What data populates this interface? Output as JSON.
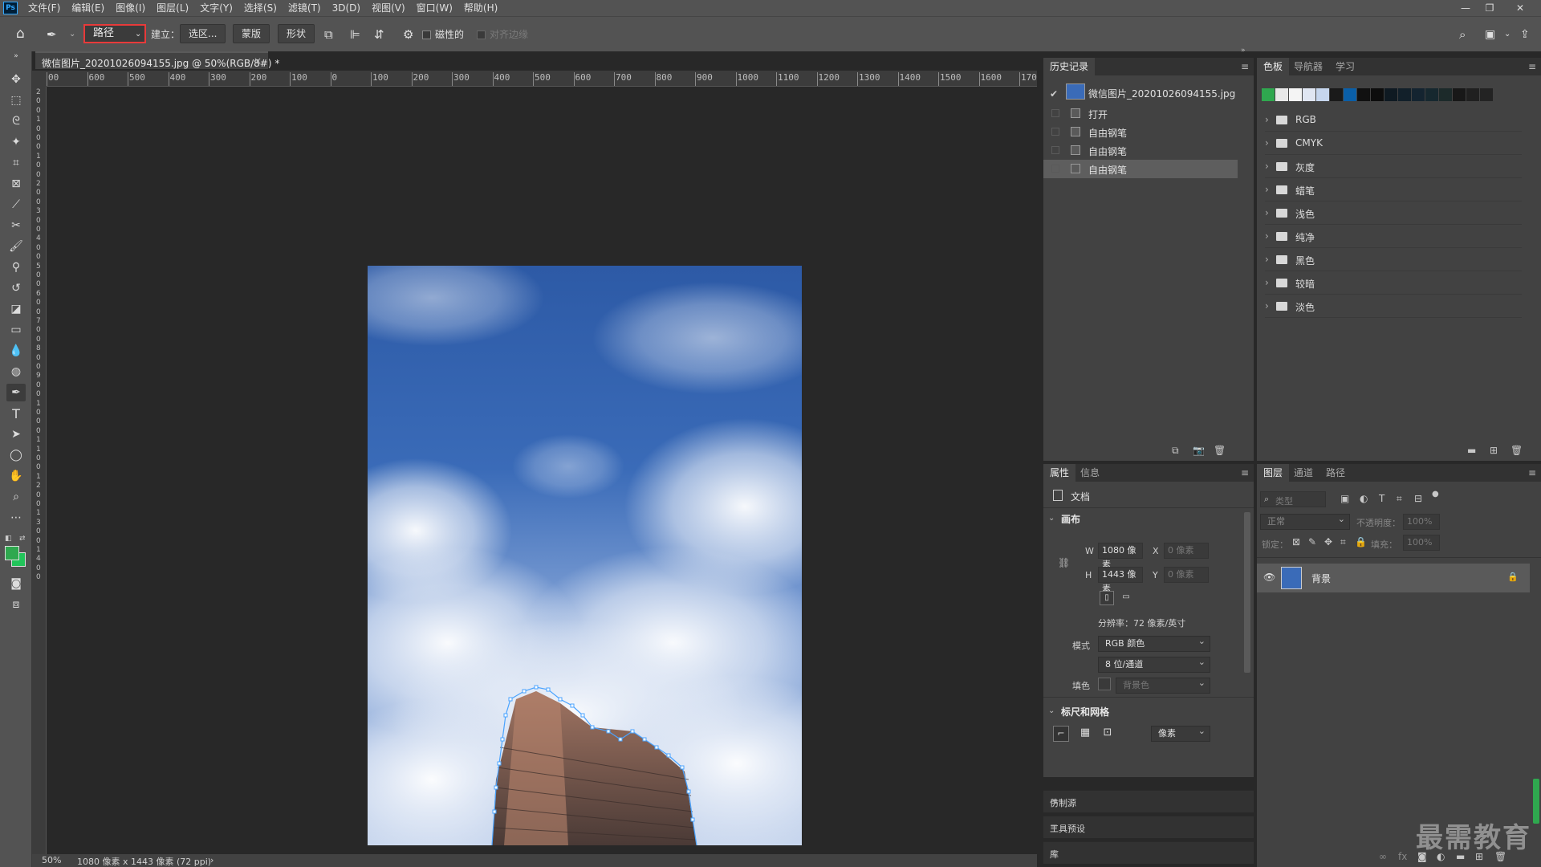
{
  "menu": {
    "logo": "Ps",
    "items": [
      "文件(F)",
      "编辑(E)",
      "图像(I)",
      "图层(L)",
      "文字(Y)",
      "选择(S)",
      "滤镜(T)",
      "3D(D)",
      "视图(V)",
      "窗口(W)",
      "帮助(H)"
    ],
    "window_controls": [
      "—",
      "❐",
      "✕"
    ]
  },
  "options_bar": {
    "mode_select": "路径",
    "build_label": "建立：",
    "selection_button": "选区...",
    "mask_button": "蒙版",
    "shape_button": "形状",
    "magnetic_label": "磁性的",
    "align_edges_label": "对齐边缘"
  },
  "document": {
    "tab_label": "微信图片_20201026094155.jpg @ 50%(RGB/8#) *",
    "close": "×"
  },
  "ruler": {
    "h_ticks": [
      "00",
      "600",
      "500",
      "400",
      "300",
      "200",
      "100",
      "0",
      "100",
      "200",
      "300",
      "400",
      "500",
      "600",
      "700",
      "800",
      "900",
      "1000",
      "1100",
      "1200",
      "1300",
      "1400",
      "1500",
      "1600",
      "1700"
    ],
    "v_ticks": [
      "2",
      "0",
      "0",
      "1",
      "0",
      "0",
      "0",
      "1",
      "0",
      "0",
      "2",
      "0",
      "0",
      "3",
      "0",
      "0",
      "4",
      "0",
      "0",
      "5",
      "0",
      "0",
      "6",
      "0",
      "0",
      "7",
      "0",
      "0",
      "8",
      "0",
      "0",
      "9",
      "0",
      "0",
      "1",
      "0",
      "0",
      "0",
      "1",
      "1",
      "0",
      "0",
      "1",
      "2",
      "0",
      "0",
      "1",
      "3",
      "0",
      "0",
      "1",
      "4",
      "0",
      "0"
    ]
  },
  "status": {
    "zoom": "50%",
    "doc_info": "1080 像素 x 1443 像素 (72 ppi)",
    "arrow": "›"
  },
  "history": {
    "tab": "历史记录",
    "snapshot_name": "微信图片_20201026094155.jpg",
    "rows": [
      "打开",
      "自由钢笔",
      "自由钢笔",
      "自由钢笔"
    ],
    "selected_index": 3
  },
  "swatches": {
    "tabs": [
      "色板",
      "导航器",
      "学习"
    ],
    "colors": [
      "#2fa84f",
      "#e8e8e8",
      "#f4f4f4",
      "#e0e6f2",
      "#c6d6ee",
      "#1a1a1a",
      "#0a5fa8",
      "#111111",
      "#0d0d0d",
      "#0f1a22",
      "#12202a",
      "#142430",
      "#16282f",
      "#1c2a2a",
      "#181818",
      "#202020",
      "#232323"
    ],
    "groups": [
      "RGB",
      "CMYK",
      "灰度",
      "蜡笔",
      "浅色",
      "纯净",
      "黑色",
      "较暗",
      "淡色"
    ]
  },
  "properties": {
    "tabs": [
      "属性",
      "信息"
    ],
    "doc_label": "文档",
    "canvas_section": "画布",
    "w_label": "W",
    "w_value": "1080 像素",
    "h_label": "H",
    "h_value": "1443 像素",
    "x_label": "X",
    "x_value": "0 像素",
    "y_label": "Y",
    "y_value": "0 像素",
    "resolution": "分辨率：72 像素/英寸",
    "mode_label": "模式",
    "mode_value": "RGB 颜色",
    "depth_value": "8 位/通道",
    "fill_label": "填色",
    "fill_value": "背景色",
    "ruler_section": "标尺和网格",
    "unit_value": "像素"
  },
  "layers": {
    "tabs": [
      "图层",
      "通道",
      "路径"
    ],
    "search_placeholder": "类型",
    "blend_mode": "正常",
    "opacity_label": "不透明度：",
    "opacity_value": "100%",
    "lock_label": "锁定：",
    "fill_label": "填充：",
    "fill_value": "100%",
    "layer_name": "背景"
  },
  "collapsed_panels": [
    "仿制源",
    "工具预设",
    "库"
  ],
  "watermark": "最需教育",
  "colors": {
    "foreground": "#2fa84f",
    "background": "#22c45a",
    "mode_highlight": "#e83a3a",
    "path_anchor": "#4aa3ff"
  }
}
